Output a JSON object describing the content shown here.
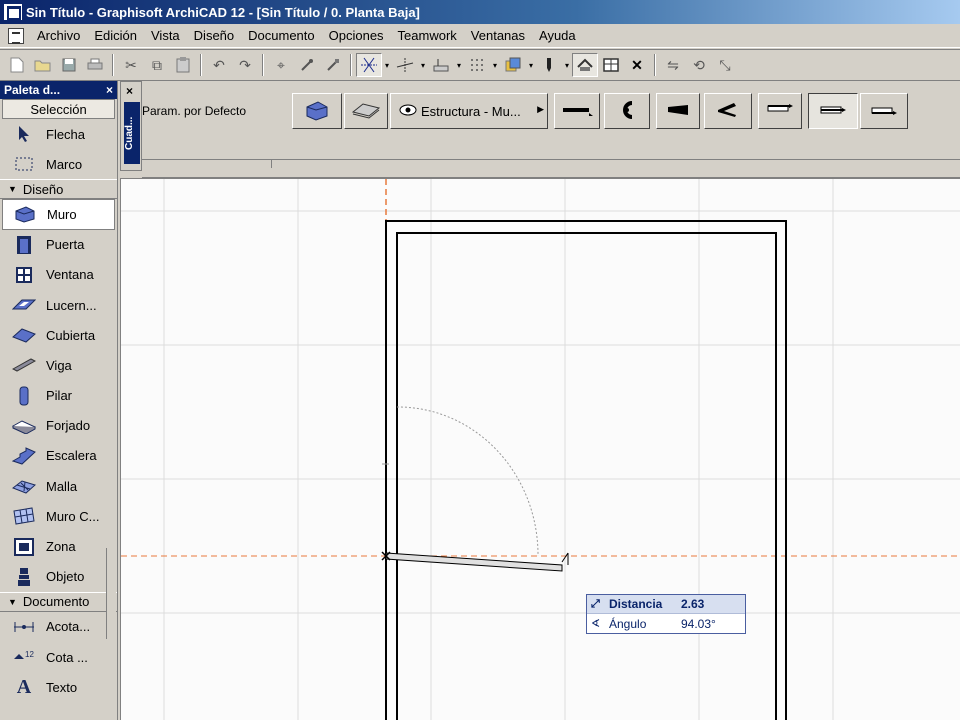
{
  "window": {
    "title": "Sin Título - Graphisoft ArchiCAD 12 - [Sin Título / 0. Planta Baja]"
  },
  "menu": {
    "items": [
      "Archivo",
      "Edición",
      "Vista",
      "Diseño",
      "Documento",
      "Opciones",
      "Teamwork",
      "Ventanas",
      "Ayuda"
    ]
  },
  "palette": {
    "title": "Paleta d...",
    "close": "×",
    "selection_label": "Selección",
    "selection_tools": [
      {
        "label": "Flecha",
        "icon": "arrow-icon"
      },
      {
        "label": "Marco",
        "icon": "marquee-icon"
      }
    ],
    "design_section": "Diseño",
    "design_tools": [
      {
        "label": "Muro",
        "icon": "wall-icon"
      },
      {
        "label": "Puerta",
        "icon": "door-icon"
      },
      {
        "label": "Ventana",
        "icon": "window-icon"
      },
      {
        "label": "Lucern...",
        "icon": "skylight-icon"
      },
      {
        "label": "Cubierta",
        "icon": "roof-icon"
      },
      {
        "label": "Viga",
        "icon": "beam-icon"
      },
      {
        "label": "Pilar",
        "icon": "column-icon"
      },
      {
        "label": "Forjado",
        "icon": "slab-icon"
      },
      {
        "label": "Escalera",
        "icon": "stair-icon"
      },
      {
        "label": "Malla",
        "icon": "mesh-icon"
      },
      {
        "label": "Muro C...",
        "icon": "curtain-wall-icon"
      },
      {
        "label": "Zona",
        "icon": "zone-icon"
      },
      {
        "label": "Objeto",
        "icon": "object-icon"
      }
    ],
    "document_section": "Documento",
    "document_tools": [
      {
        "label": "Acota...",
        "icon": "dimension-icon"
      },
      {
        "label": "Cota ...",
        "icon": "level-dimension-icon"
      },
      {
        "label": "Texto",
        "icon": "text-icon"
      }
    ]
  },
  "infobox": {
    "vertical_label": "Cuad...",
    "close": "×",
    "param_label": "Param. por Defecto",
    "structure_button": "Estructura - Mu..."
  },
  "tracker": {
    "distance_label": "Distancia",
    "distance_value": "2.63",
    "angle_label": "Ángulo",
    "angle_value": "94.03°"
  },
  "colors": {
    "titlebar": "#0a246a",
    "guide_line": "#e87a3c",
    "wall_line": "#000000",
    "grid": "#dcdcdc",
    "tracker_text": "#0a246a"
  }
}
